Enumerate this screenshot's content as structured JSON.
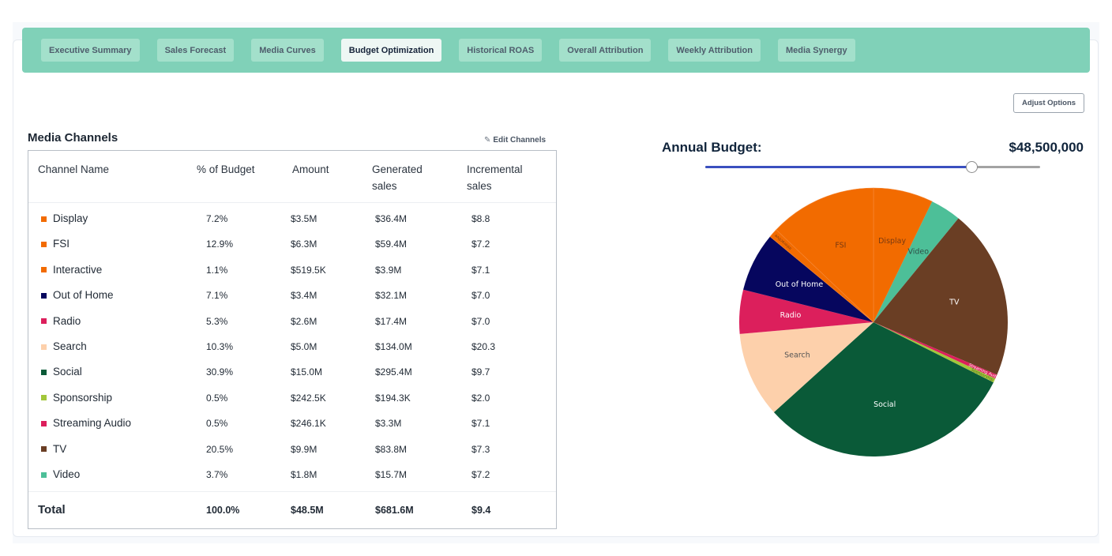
{
  "tabs": [
    {
      "label": "Executive Summary",
      "active": false
    },
    {
      "label": "Sales Forecast",
      "active": false
    },
    {
      "label": "Media Curves",
      "active": false
    },
    {
      "label": "Budget Optimization",
      "active": true
    },
    {
      "label": "Historical ROAS",
      "active": false
    },
    {
      "label": "Overall Attribution",
      "active": false
    },
    {
      "label": "Weekly Attribution",
      "active": false
    },
    {
      "label": "Media Synergy",
      "active": false
    }
  ],
  "adjust_options_label": "Adjust Options",
  "media_channels": {
    "title": "Media Channels",
    "edit_label": "Edit Channels",
    "edit_icon": "edit-icon",
    "columns": [
      "Channel Name",
      "% of Budget",
      "Amount",
      "Generated sales",
      "Incremental sales"
    ],
    "columns_lines": [
      [
        "Channel Name"
      ],
      [
        "% of Budget"
      ],
      [
        "Amount"
      ],
      [
        "Generated",
        "sales"
      ],
      [
        "Incremental",
        "sales"
      ]
    ],
    "rows": [
      {
        "name": "Display",
        "color": "#f26b00",
        "pct": "7.2%",
        "amount": "$3.5M",
        "generated": "$36.4M",
        "incremental": "$8.8"
      },
      {
        "name": "FSI",
        "color": "#f26b00",
        "pct": "12.9%",
        "amount": "$6.3M",
        "generated": "$59.4M",
        "incremental": "$7.2"
      },
      {
        "name": "Interactive",
        "color": "#f26b00",
        "pct": "1.1%",
        "amount": "$519.5K",
        "generated": "$3.9M",
        "incremental": "$7.1"
      },
      {
        "name": "Out of Home",
        "color": "#06065e",
        "pct": "7.1%",
        "amount": "$3.4M",
        "generated": "$32.1M",
        "incremental": "$7.0"
      },
      {
        "name": "Radio",
        "color": "#dc1f5c",
        "pct": "5.3%",
        "amount": "$2.6M",
        "generated": "$17.4M",
        "incremental": "$7.0"
      },
      {
        "name": "Search",
        "color": "#fdd0ab",
        "pct": "10.3%",
        "amount": "$5.0M",
        "generated": "$134.0M",
        "incremental": "$20.3"
      },
      {
        "name": "Social",
        "color": "#0a5a38",
        "pct": "30.9%",
        "amount": "$15.0M",
        "generated": "$295.4M",
        "incremental": "$9.7"
      },
      {
        "name": "Sponsorship",
        "color": "#a2c73a",
        "pct": "0.5%",
        "amount": "$242.5K",
        "generated": "$194.3K",
        "incremental": "$2.0"
      },
      {
        "name": "Streaming Audio",
        "color": "#dc1f5c",
        "pct": "0.5%",
        "amount": "$246.1K",
        "generated": "$3.3M",
        "incremental": "$7.1"
      },
      {
        "name": "TV",
        "color": "#6a3e24",
        "pct": "20.5%",
        "amount": "$9.9M",
        "generated": "$83.8M",
        "incremental": "$7.3"
      },
      {
        "name": "Video",
        "color": "#4dbf98",
        "pct": "3.7%",
        "amount": "$1.8M",
        "generated": "$15.7M",
        "incremental": "$7.2"
      }
    ],
    "total": {
      "name": "Total",
      "pct": "100.0%",
      "amount": "$48.5M",
      "generated": "$681.6M",
      "incremental": "$9.4"
    }
  },
  "annual_budget": {
    "label": "Annual Budget:",
    "value": "$48,500,000",
    "slider_fraction": 0.795
  },
  "chart_data": {
    "type": "pie",
    "title": "",
    "direction": "clockwise",
    "start": "12 o'clock",
    "slices": [
      {
        "label": "Display",
        "value": 7.2,
        "color": "#f26b00",
        "text_color": "#7a3a10"
      },
      {
        "label": "Video",
        "value": 3.7,
        "color": "#4dbf98",
        "text_color": "#2f4f47"
      },
      {
        "label": "TV",
        "value": 20.5,
        "color": "#6a3e24",
        "text_color": "#ffffff"
      },
      {
        "label": "Streaming Audio",
        "value": 0.5,
        "color": "#dc1f5c",
        "text_color": "#ffffff"
      },
      {
        "label": "Sponsorship",
        "value": 0.5,
        "color": "#a2c73a",
        "text_color": "#556b20"
      },
      {
        "label": "Social",
        "value": 30.9,
        "color": "#0a5a38",
        "text_color": "#ffffff"
      },
      {
        "label": "Search",
        "value": 10.3,
        "color": "#fdd0ab",
        "text_color": "#555555"
      },
      {
        "label": "Radio",
        "value": 5.3,
        "color": "#dc1f5c",
        "text_color": "#ffffff"
      },
      {
        "label": "Out of Home",
        "value": 7.1,
        "color": "#06065e",
        "text_color": "#ffffff"
      },
      {
        "label": "Interactive",
        "value": 1.1,
        "color": "#f26b00",
        "text_color": "#7a3a10"
      },
      {
        "label": "FSI",
        "value": 12.9,
        "color": "#f26b00",
        "text_color": "#7a3a10"
      }
    ]
  }
}
